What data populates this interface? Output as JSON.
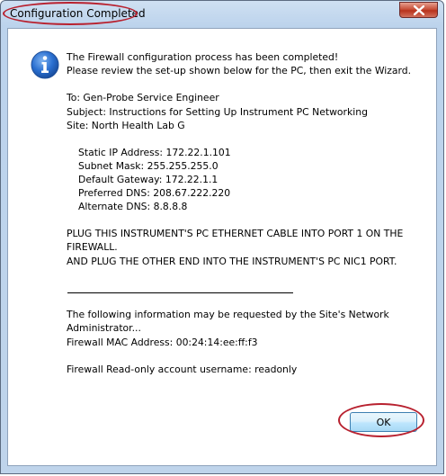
{
  "window": {
    "title": "Configuration Completed",
    "close_icon": "close-icon"
  },
  "message": {
    "icon": "info-icon",
    "intro_line1": "The Firewall configuration process has been completed!",
    "intro_line2": "Please review the set-up shown below for the PC, then exit the Wizard.",
    "to": "To: Gen-Probe Service Engineer",
    "subject": "Subject: Instructions for Setting Up Instrument PC Networking",
    "site": "Site: North Health Lab G",
    "network": [
      "Static IP Address: 172.22.1.101",
      "Subnet Mask: 255.255.255.0",
      "Default Gateway: 172.22.1.1",
      "Preferred DNS: 208.67.222.220",
      "Alternate DNS: 8.8.8.8"
    ],
    "instruction_line1": "PLUG THIS INSTRUMENT'S PC ETHERNET CABLE INTO PORT 1 ON THE",
    "instruction_line2": "FIREWALL.",
    "instruction_line3": "AND PLUG THE OTHER END INTO THE INSTRUMENT'S PC NIC1 PORT.",
    "admin_line1": "The following information may be requested by the Site's Network",
    "admin_line2": "Administrator...",
    "mac_address": "Firewall MAC Address: 00:24:14:ee:ff:f3",
    "readonly_account": "Firewall Read-only account username: readonly"
  },
  "buttons": {
    "ok_label": "OK"
  },
  "colors": {
    "annotation_ellipse": "#b8212f",
    "titlebar": "#bcd3ec",
    "ok_border": "#3c7fb1"
  }
}
